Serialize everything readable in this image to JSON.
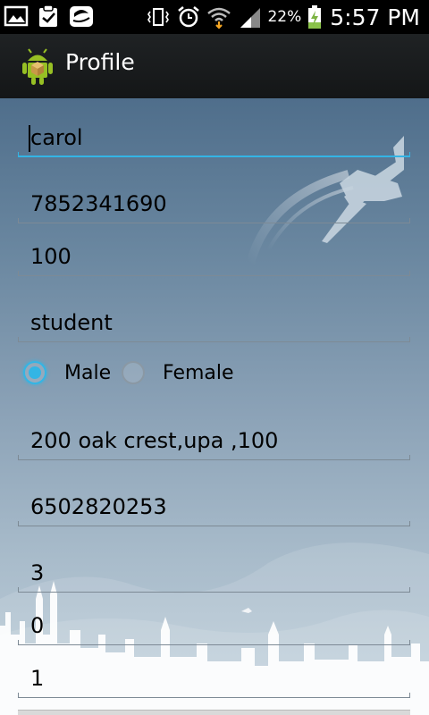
{
  "status_bar": {
    "battery": "22%",
    "time": "5:57 PM",
    "icons": [
      "gallery-icon",
      "clipboard-check-icon",
      "chat-app-icon",
      "vibrate-icon",
      "alarm-icon",
      "wifi-icon",
      "signal-icon",
      "battery-charging-icon"
    ]
  },
  "action_bar": {
    "title": "Profile",
    "icon": "android-robot-icon"
  },
  "form": {
    "name": "carol",
    "phone": "7852341690",
    "age": "100",
    "occupation": "student",
    "gender_options": [
      "Male",
      "Female"
    ],
    "gender_selected": "Male",
    "address": "200 oak crest,upa ,100",
    "contact_phone": "6502820253",
    "field_a": "3",
    "field_b": "0",
    "field_c": "1"
  },
  "colors": {
    "accent": "#33b5e5",
    "action_bar": "#1f2224"
  }
}
